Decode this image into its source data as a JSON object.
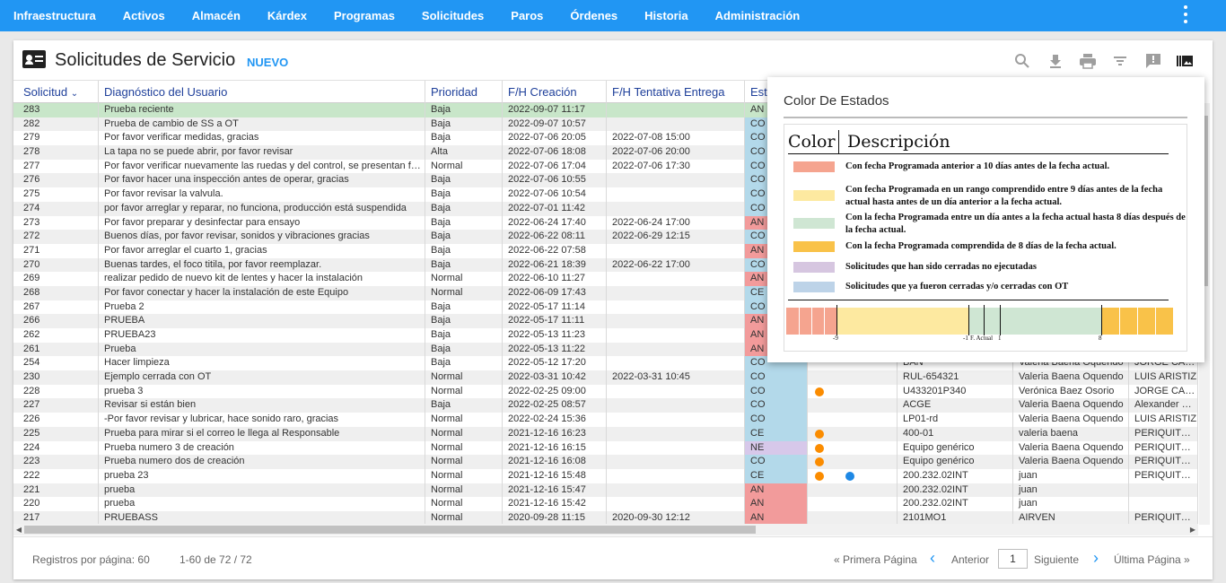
{
  "nav": {
    "items": [
      "Infraestructura",
      "Activos",
      "Almacén",
      "Kárdex",
      "Programas",
      "Solicitudes",
      "Paros",
      "Órdenes",
      "Historia",
      "Administración"
    ]
  },
  "header": {
    "title": "Solicitudes de Servicio",
    "nuevo": "NUEVO",
    "tools": [
      "search-icon",
      "download-icon",
      "print-icon",
      "filter-icon",
      "feedback-icon",
      "color-legend-icon"
    ]
  },
  "table": {
    "columns": [
      "Solicitud",
      "Diagnóstico del Usuario",
      "Prioridad",
      "F/H Creación",
      "F/H Tentativa Entrega",
      "Est"
    ],
    "rows": [
      {
        "id": "283",
        "diag": "Prueba reciente",
        "prio": "Baja",
        "created": "2022-09-07 11:17",
        "due": "",
        "status": "AN",
        "status_color": "#c8e6c9",
        "hl": true,
        "dots": [],
        "activo": "",
        "resp": "",
        "sup": ""
      },
      {
        "id": "282",
        "diag": "Prueba de cambio de SS a OT",
        "prio": "Baja",
        "created": "2022-09-07 10:57",
        "due": "",
        "status": "CO",
        "status_color": "#b3d9ea",
        "dots": [],
        "activo": "",
        "resp": "",
        "sup": ""
      },
      {
        "id": "279",
        "diag": "Por favor verificar medidas, gracias",
        "prio": "Baja",
        "created": "2022-07-06 20:05",
        "due": "2022-07-08 15:00",
        "status": "CO",
        "status_color": "#b3d9ea",
        "dots": [],
        "activo": "",
        "resp": "",
        "sup": ""
      },
      {
        "id": "278",
        "diag": "La tapa no se puede abrir, por favor revisar",
        "prio": "Alta",
        "created": "2022-07-06 18:08",
        "due": "2022-07-06 20:00",
        "status": "CO",
        "status_color": "#b3d9ea",
        "dots": [],
        "activo": "",
        "resp": "",
        "sup": ""
      },
      {
        "id": "277",
        "diag": "Por favor verificar nuevamente las ruedas y del control, se presentan fallas",
        "prio": "Normal",
        "created": "2022-07-06 17:04",
        "due": "2022-07-06 17:30",
        "status": "CO",
        "status_color": "#b3d9ea",
        "dots": [],
        "activo": "",
        "resp": "",
        "sup": ""
      },
      {
        "id": "276",
        "diag": "Por favor hacer una inspección antes de operar, gracias",
        "prio": "Baja",
        "created": "2022-07-06 10:55",
        "due": "",
        "status": "CO",
        "status_color": "#b3d9ea",
        "dots": [],
        "activo": "",
        "resp": "",
        "sup": ""
      },
      {
        "id": "275",
        "diag": "Por favor revisar la valvula.",
        "prio": "Baja",
        "created": "2022-07-06 10:54",
        "due": "",
        "status": "CO",
        "status_color": "#b3d9ea",
        "dots": [],
        "activo": "",
        "resp": "",
        "sup": ""
      },
      {
        "id": "274",
        "diag": "por favor arreglar y reparar, no funciona, producción está suspendida",
        "prio": "Baja",
        "created": "2022-07-01 11:42",
        "due": "",
        "status": "CO",
        "status_color": "#b3d9ea",
        "dots": [],
        "activo": "",
        "resp": "",
        "sup": ""
      },
      {
        "id": "273",
        "diag": "Por favor preparar y desinfectar para ensayo",
        "prio": "Baja",
        "created": "2022-06-24 17:40",
        "due": "2022-06-24 17:00",
        "status": "AN",
        "status_color": "#f29b9b",
        "dots": [],
        "activo": "",
        "resp": "",
        "sup": ""
      },
      {
        "id": "272",
        "diag": "Buenos días, por favor revisar, sonidos y vibraciones gracias",
        "prio": "Baja",
        "created": "2022-06-22 08:11",
        "due": "2022-06-29 12:15",
        "status": "CO",
        "status_color": "#b3d9ea",
        "dots": [],
        "activo": "",
        "resp": "",
        "sup": ""
      },
      {
        "id": "271",
        "diag": "Por favor arreglar el cuarto 1, gracias",
        "prio": "Baja",
        "created": "2022-06-22 07:58",
        "due": "",
        "status": "AN",
        "status_color": "#f29b9b",
        "dots": [],
        "activo": "",
        "resp": "",
        "sup": ""
      },
      {
        "id": "270",
        "diag": "Buenas tardes, el foco titila, por favor reemplazar.",
        "prio": "Baja",
        "created": "2022-06-21 18:39",
        "due": "2022-06-22 17:00",
        "status": "CO",
        "status_color": "#b3d9ea",
        "dots": [],
        "activo": "",
        "resp": "",
        "sup": ""
      },
      {
        "id": "269",
        "diag": "realizar pedido de nuevo kit de lentes y hacer la instalación",
        "prio": "Normal",
        "created": "2022-06-10 11:27",
        "due": "",
        "status": "AN",
        "status_color": "#f29b9b",
        "dots": [],
        "activo": "",
        "resp": "",
        "sup": ""
      },
      {
        "id": "268",
        "diag": "Por favor conectar y hacer la instalación de este Equipo",
        "prio": "Normal",
        "created": "2022-06-09 17:43",
        "due": "",
        "status": "CE",
        "status_color": "#b3d9ea",
        "dots": [],
        "activo": "",
        "resp": "",
        "sup": ""
      },
      {
        "id": "267",
        "diag": "Prueba 2",
        "prio": "Baja",
        "created": "2022-05-17 11:14",
        "due": "",
        "status": "CO",
        "status_color": "#b3d9ea",
        "dots": [],
        "activo": "",
        "resp": "",
        "sup": ""
      },
      {
        "id": "266",
        "diag": "PRUEBA",
        "prio": "Baja",
        "created": "2022-05-17 11:11",
        "due": "",
        "status": "AN",
        "status_color": "#f29b9b",
        "dots": [],
        "activo": "",
        "resp": "",
        "sup": ""
      },
      {
        "id": "262",
        "diag": "PRUEBA23",
        "prio": "Baja",
        "created": "2022-05-13 11:23",
        "due": "",
        "status": "AN",
        "status_color": "#f29b9b",
        "dots": [],
        "activo": "",
        "resp": "",
        "sup": ""
      },
      {
        "id": "261",
        "diag": "Prueba",
        "prio": "Baja",
        "created": "2022-05-13 11:22",
        "due": "",
        "status": "AN",
        "status_color": "#f29b9b",
        "dots": [],
        "activo": "",
        "resp": "",
        "sup": ""
      },
      {
        "id": "254",
        "diag": "Hacer limpieza",
        "prio": "Baja",
        "created": "2022-05-12 17:20",
        "due": "",
        "status": "CO",
        "status_color": "#b3d9ea",
        "dots": [],
        "activo": "BAN",
        "resp": "Valeria Baena Oquendo",
        "sup": "JORGE CARDE"
      },
      {
        "id": "230",
        "diag": "Ejemplo cerrada con OT",
        "prio": "Normal",
        "created": "2022-03-31 10:42",
        "due": "2022-03-31 10:45",
        "status": "CO",
        "status_color": "#b3d9ea",
        "dots": [],
        "activo": "RUL-654321",
        "resp": "Valeria Baena Oquendo",
        "sup": "LUIS ARISTIZ"
      },
      {
        "id": "228",
        "diag": "prueba 3",
        "prio": "Normal",
        "created": "2022-02-25 09:00",
        "due": "",
        "status": "CO",
        "status_color": "#b3d9ea",
        "dots": [
          "orange"
        ],
        "activo": "U433201P340",
        "resp": "Verónica Baez Osorio",
        "sup": "JORGE CARDE"
      },
      {
        "id": "227",
        "diag": "Revisar si están bien",
        "prio": "Baja",
        "created": "2022-02-25 08:57",
        "due": "",
        "status": "CO",
        "status_color": "#b3d9ea",
        "dots": [],
        "activo": "ACGE",
        "resp": "Valeria Baena Oquendo",
        "sup": "Alexander Cab"
      },
      {
        "id": "226",
        "diag": "-Por favor revisar y lubricar, hace sonido raro, gracias",
        "prio": "Normal",
        "created": "2022-02-24 15:36",
        "due": "",
        "status": "CO",
        "status_color": "#b3d9ea",
        "dots": [],
        "activo": "LP01-rd",
        "resp": "Valeria Baena Oquendo",
        "sup": "LUIS ARISTIZ"
      },
      {
        "id": "225",
        "diag": "Prueba para mirar si el correo le llega al Responsable",
        "prio": "Normal",
        "created": "2021-12-16 16:23",
        "due": "",
        "status": "CE",
        "status_color": "#b3d9ea",
        "dots": [
          "orange"
        ],
        "activo": "400-01",
        "resp": "valeria baena",
        "sup": "PERIQUITO CA"
      },
      {
        "id": "224",
        "diag": "Prueba numero 3 de creación",
        "prio": "Normal",
        "created": "2021-12-16 16:15",
        "due": "",
        "status": "NE",
        "status_color": "#d7c8ea",
        "dots": [
          "orange"
        ],
        "activo": "Equipo genérico",
        "resp": "Valeria Baena Oquendo",
        "sup": "PERIQUITO CA"
      },
      {
        "id": "223",
        "diag": "Prueba numero dos de creación",
        "prio": "Normal",
        "created": "2021-12-16 16:08",
        "due": "",
        "status": "CO",
        "status_color": "#b3d9ea",
        "dots": [
          "orange"
        ],
        "activo": "Equipo genérico",
        "resp": "Valeria Baena Oquendo",
        "sup": "PERIQUITO CA"
      },
      {
        "id": "222",
        "diag": "prueba 23",
        "prio": "Normal",
        "created": "2021-12-16 15:48",
        "due": "",
        "status": "CE",
        "status_color": "#b3d9ea",
        "dots": [
          "orange",
          "blue"
        ],
        "activo": "200.232.02INT",
        "resp": "juan",
        "sup": "PERIQUITO CA"
      },
      {
        "id": "221",
        "diag": "prueba",
        "prio": "Normal",
        "created": "2021-12-16 15:47",
        "due": "",
        "status": "AN",
        "status_color": "#f29b9b",
        "dots": [],
        "activo": "200.232.02INT",
        "resp": "juan",
        "sup": ""
      },
      {
        "id": "220",
        "diag": "prueba",
        "prio": "Normal",
        "created": "2021-12-16 15:42",
        "due": "",
        "status": "AN",
        "status_color": "#f29b9b",
        "dots": [],
        "activo": "200.232.02INT",
        "resp": "juan",
        "sup": ""
      },
      {
        "id": "217",
        "diag": "PRUEBASS",
        "prio": "Normal",
        "created": "2020-09-28 11:15",
        "due": "2020-09-30 12:12",
        "status": "AN",
        "status_color": "#f29b9b",
        "dots": [],
        "activo": "2101MO1",
        "resp": "AIRVEN",
        "sup": "PERIQUITO CA"
      }
    ]
  },
  "footer": {
    "per_page": "Registros por página: 60",
    "range": "1-60 de 72 / 72",
    "first": "« Primera Página",
    "prev": "Anterior",
    "page": "1",
    "next": "Siguiente",
    "last": "Última Página »"
  },
  "popup": {
    "title": "Color De Estados",
    "col_color": "Color",
    "col_desc": "Descripción",
    "items": [
      {
        "color": "#f5a48f",
        "text": "Con fecha Programada anterior a 10 días antes de la fecha actual."
      },
      {
        "color": "#fde9a0",
        "text": "Con fecha Programada en un rango comprendido entre 9 días antes de la fecha actual hasta antes de un día anterior a la fecha actual."
      },
      {
        "color": "#cfe6d3",
        "text": "Con la fecha Programada  entre un día antes a la fecha actual hasta 8 días después de la fecha actual."
      },
      {
        "color": "#f9c249",
        "text": "Con la fecha Programada comprendida de 8 días de la fecha actual."
      },
      {
        "color": "#d6c6e0",
        "text": "Solicitudes que han sido cerradas no ejecutadas"
      },
      {
        "color": "#bdd3e8",
        "text": "Solicitudes que ya fueron cerradas y/o cerradas con OT"
      }
    ],
    "scale_labels": [
      "-9",
      "-1",
      "F. Actual",
      "1",
      "8"
    ]
  }
}
